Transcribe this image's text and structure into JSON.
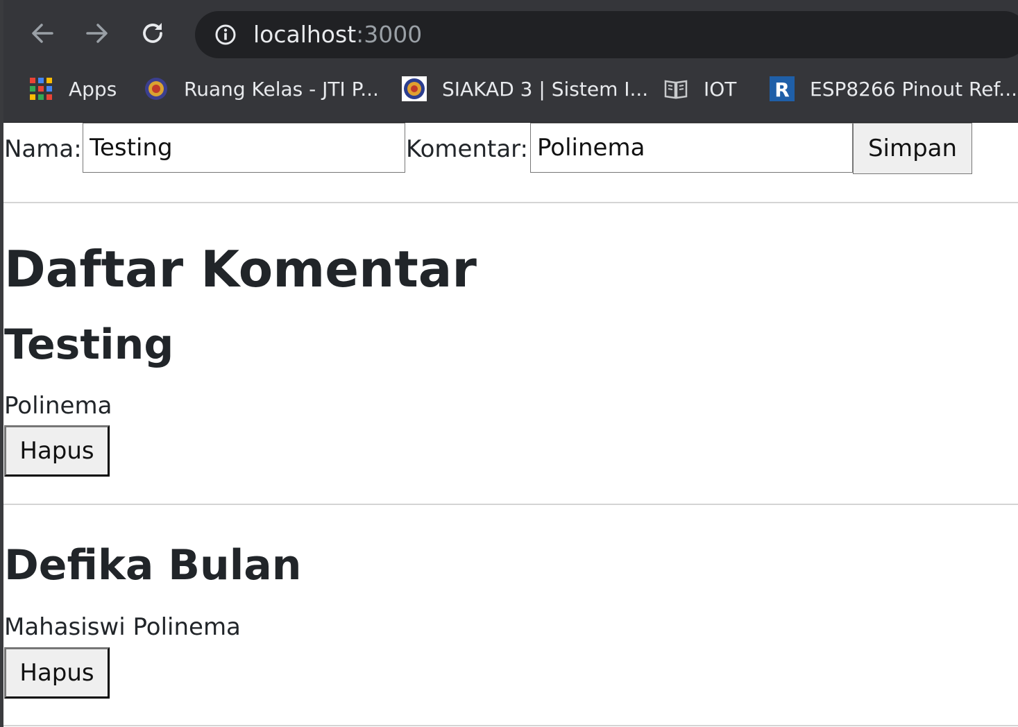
{
  "browser": {
    "url_host": "localhost",
    "url_port": ":3000",
    "bookmarks": [
      {
        "label": "Apps",
        "icon": "apps-grid-icon"
      },
      {
        "label": "Ruang Kelas - JTI P...",
        "icon": "polinema-logo-icon"
      },
      {
        "label": "SIAKAD 3 | Sistem I...",
        "icon": "polinema-logo-icon"
      },
      {
        "label": "IOT",
        "icon": "book-icon"
      },
      {
        "label": "ESP8266 Pinout Ref...",
        "icon": "r-logo-icon"
      }
    ]
  },
  "form": {
    "nama_label": "Nama:",
    "nama_value": "Testing",
    "komentar_label": "Komentar:",
    "komentar_value": "Polinema",
    "submit_label": "Simpan"
  },
  "list": {
    "title": "Daftar Komentar",
    "comments": [
      {
        "nama": "Testing",
        "komentar": "Polinema",
        "delete_label": "Hapus"
      },
      {
        "nama": "Defika Bulan",
        "komentar": "Mahasiswi Polinema",
        "delete_label": "Hapus"
      }
    ]
  }
}
